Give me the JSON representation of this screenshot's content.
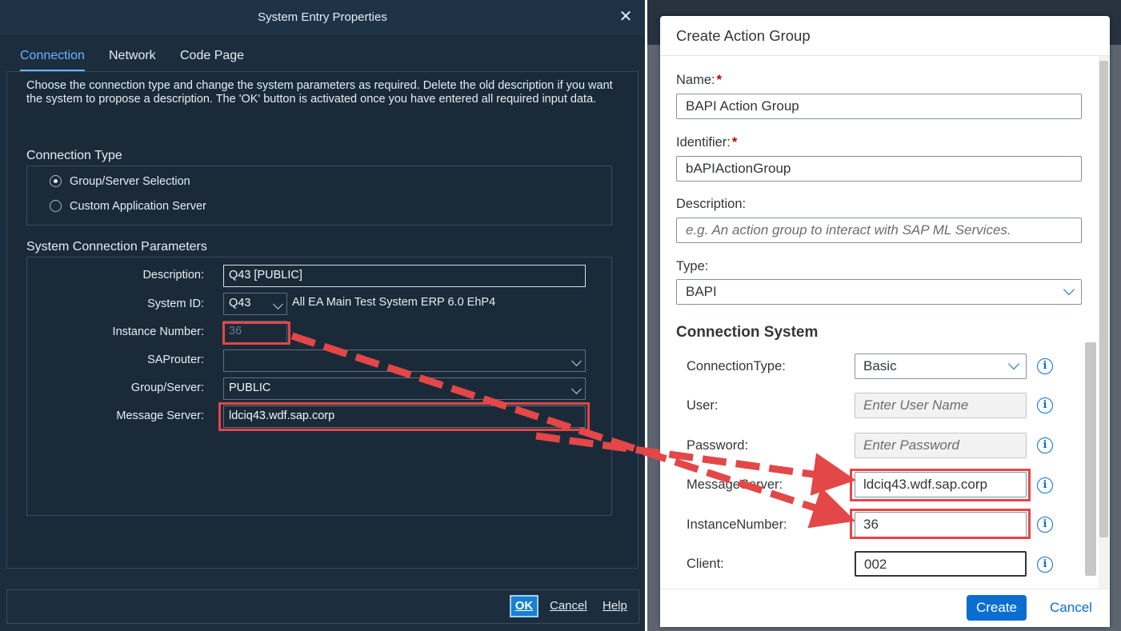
{
  "left_dialog": {
    "title": "System Entry Properties",
    "close_glyph": "✕",
    "tabs": [
      {
        "label": "Connection",
        "active": true
      },
      {
        "label": "Network",
        "active": false
      },
      {
        "label": "Code Page",
        "active": false
      }
    ],
    "intro": "Choose the connection type and change the system parameters as required. Delete the old description if you want the system to propose a description. The 'OK' button is activated once you have entered all required input data.",
    "connection_type": {
      "heading": "Connection Type",
      "options": [
        {
          "label": "Group/Server Selection",
          "selected": true
        },
        {
          "label": "Custom Application Server",
          "selected": false
        }
      ]
    },
    "params": {
      "heading": "System Connection Parameters",
      "description_label": "Description:",
      "description_value": "Q43 [PUBLIC]",
      "system_id_label": "System ID:",
      "system_id_value": "Q43",
      "system_name": "All EA Main Test System ERP 6.0 EhP4",
      "instance_label": "Instance Number:",
      "instance_value": "36",
      "saprouter_label": "SAProuter:",
      "saprouter_value": "",
      "group_label": "Group/Server:",
      "group_value": "PUBLIC",
      "msgserver_label": "Message Server:",
      "msgserver_value": "ldciq43.wdf.sap.corp"
    },
    "footer": {
      "ok": "OK",
      "cancel": "Cancel",
      "help": "Help"
    }
  },
  "right_dialog": {
    "title": "Create Action Group",
    "name_label": "Name:",
    "name_value": "BAPI Action Group",
    "identifier_label": "Identifier:",
    "identifier_value": "bAPIActionGroup",
    "description_label": "Description:",
    "description_placeholder": "e.g. An action group to interact with SAP ML Services.",
    "type_label": "Type:",
    "type_value": "BAPI",
    "required_mark": "*",
    "connection_heading": "Connection System",
    "info_glyph": "i",
    "fields": {
      "connection_type_label": "ConnectionType:",
      "connection_type_value": "Basic",
      "user_label": "User:",
      "user_placeholder": "Enter User Name",
      "password_label": "Password:",
      "password_placeholder": "Enter Password",
      "message_server_label": "MessageServer:",
      "message_server_value": "ldciq43.wdf.sap.corp",
      "instance_label": "InstanceNumber:",
      "instance_value": "36",
      "client_label": "Client:",
      "client_value": "002"
    },
    "footer": {
      "create": "Create",
      "cancel": "Cancel"
    }
  },
  "colors": {
    "left_bg": "#1c2d3d",
    "left_accent": "#69b6ff",
    "fiori_blue": "#0a6ed1",
    "highlight_red": "#e34747"
  }
}
